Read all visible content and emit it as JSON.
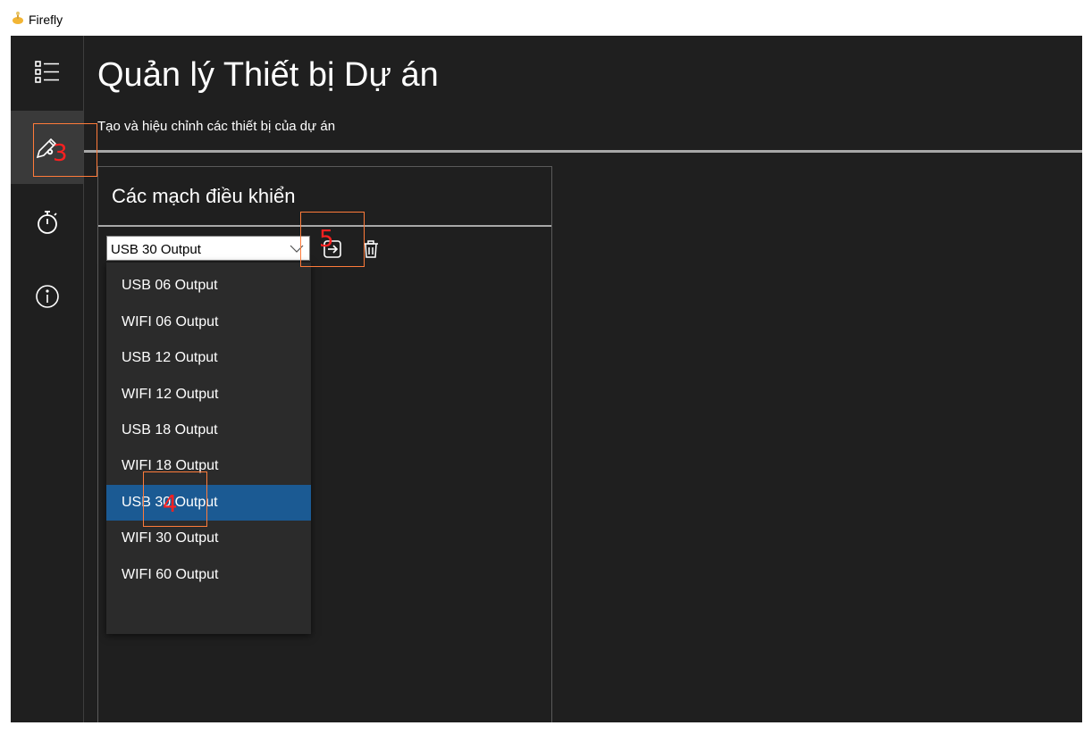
{
  "window": {
    "title": "Firefly",
    "icon": "firefly-app-icon"
  },
  "nav": {
    "items": [
      {
        "name": "list-icon",
        "active": false
      },
      {
        "name": "device-settings-icon",
        "active": true
      },
      {
        "name": "timer-icon",
        "active": false
      },
      {
        "name": "info-icon",
        "active": false
      }
    ]
  },
  "page": {
    "title": "Quản lý Thiết bị Dự án",
    "subtitle": "Tạo và hiệu chỉnh các thiết bị của dự án"
  },
  "panel": {
    "title": "Các mạch điều khiển",
    "combo_value": "USB 30 Output",
    "options": [
      "USB 06 Output",
      "WIFI 06 Output",
      "USB 12 Output",
      "WIFI 12 Output",
      "USB 18 Output",
      "WIFI 18 Output",
      "USB 30 Output",
      "WIFI 30 Output",
      "WIFI 60 Output"
    ],
    "selected_index": 6
  },
  "annotations": {
    "a3": "3",
    "a4": "4",
    "a5": "5"
  },
  "colors": {
    "background": "#1f1f1f",
    "selected": "#1b5a93",
    "annotation": "#ff2020"
  }
}
